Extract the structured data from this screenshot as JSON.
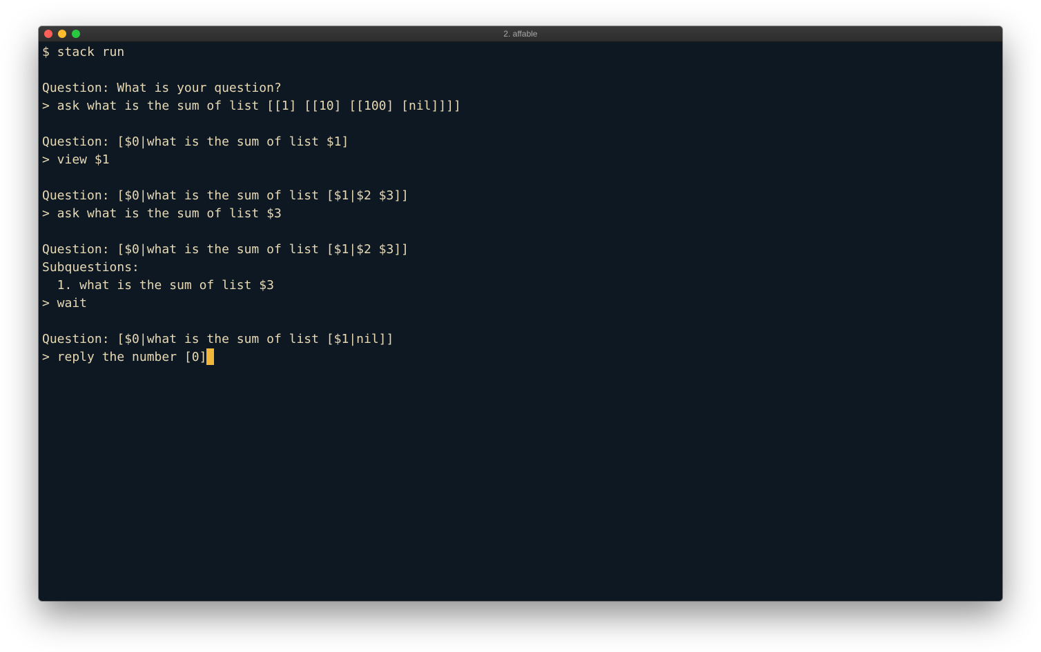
{
  "window": {
    "title": "2. affable",
    "traffic_lights": {
      "close_color": "#fe5f57",
      "minimize_color": "#febc2e",
      "zoom_color": "#28c840"
    }
  },
  "terminal": {
    "background_color": "#0d1822",
    "text_color": "#e8d9b5",
    "cursor_color": "#f2b63c",
    "lines": [
      "$ stack run",
      "",
      "Question: What is your question?",
      "> ask what is the sum of list [[1] [[10] [[100] [nil]]]]",
      "",
      "Question: [$0|what is the sum of list $1]",
      "> view $1",
      "",
      "Question: [$0|what is the sum of list [$1|$2 $3]]",
      "> ask what is the sum of list $3",
      "",
      "Question: [$0|what is the sum of list [$1|$2 $3]]",
      "Subquestions:",
      "  1. what is the sum of list $3",
      "> wait",
      "",
      "Question: [$0|what is the sum of list [$1|nil]]",
      "> reply the number [0]"
    ]
  }
}
